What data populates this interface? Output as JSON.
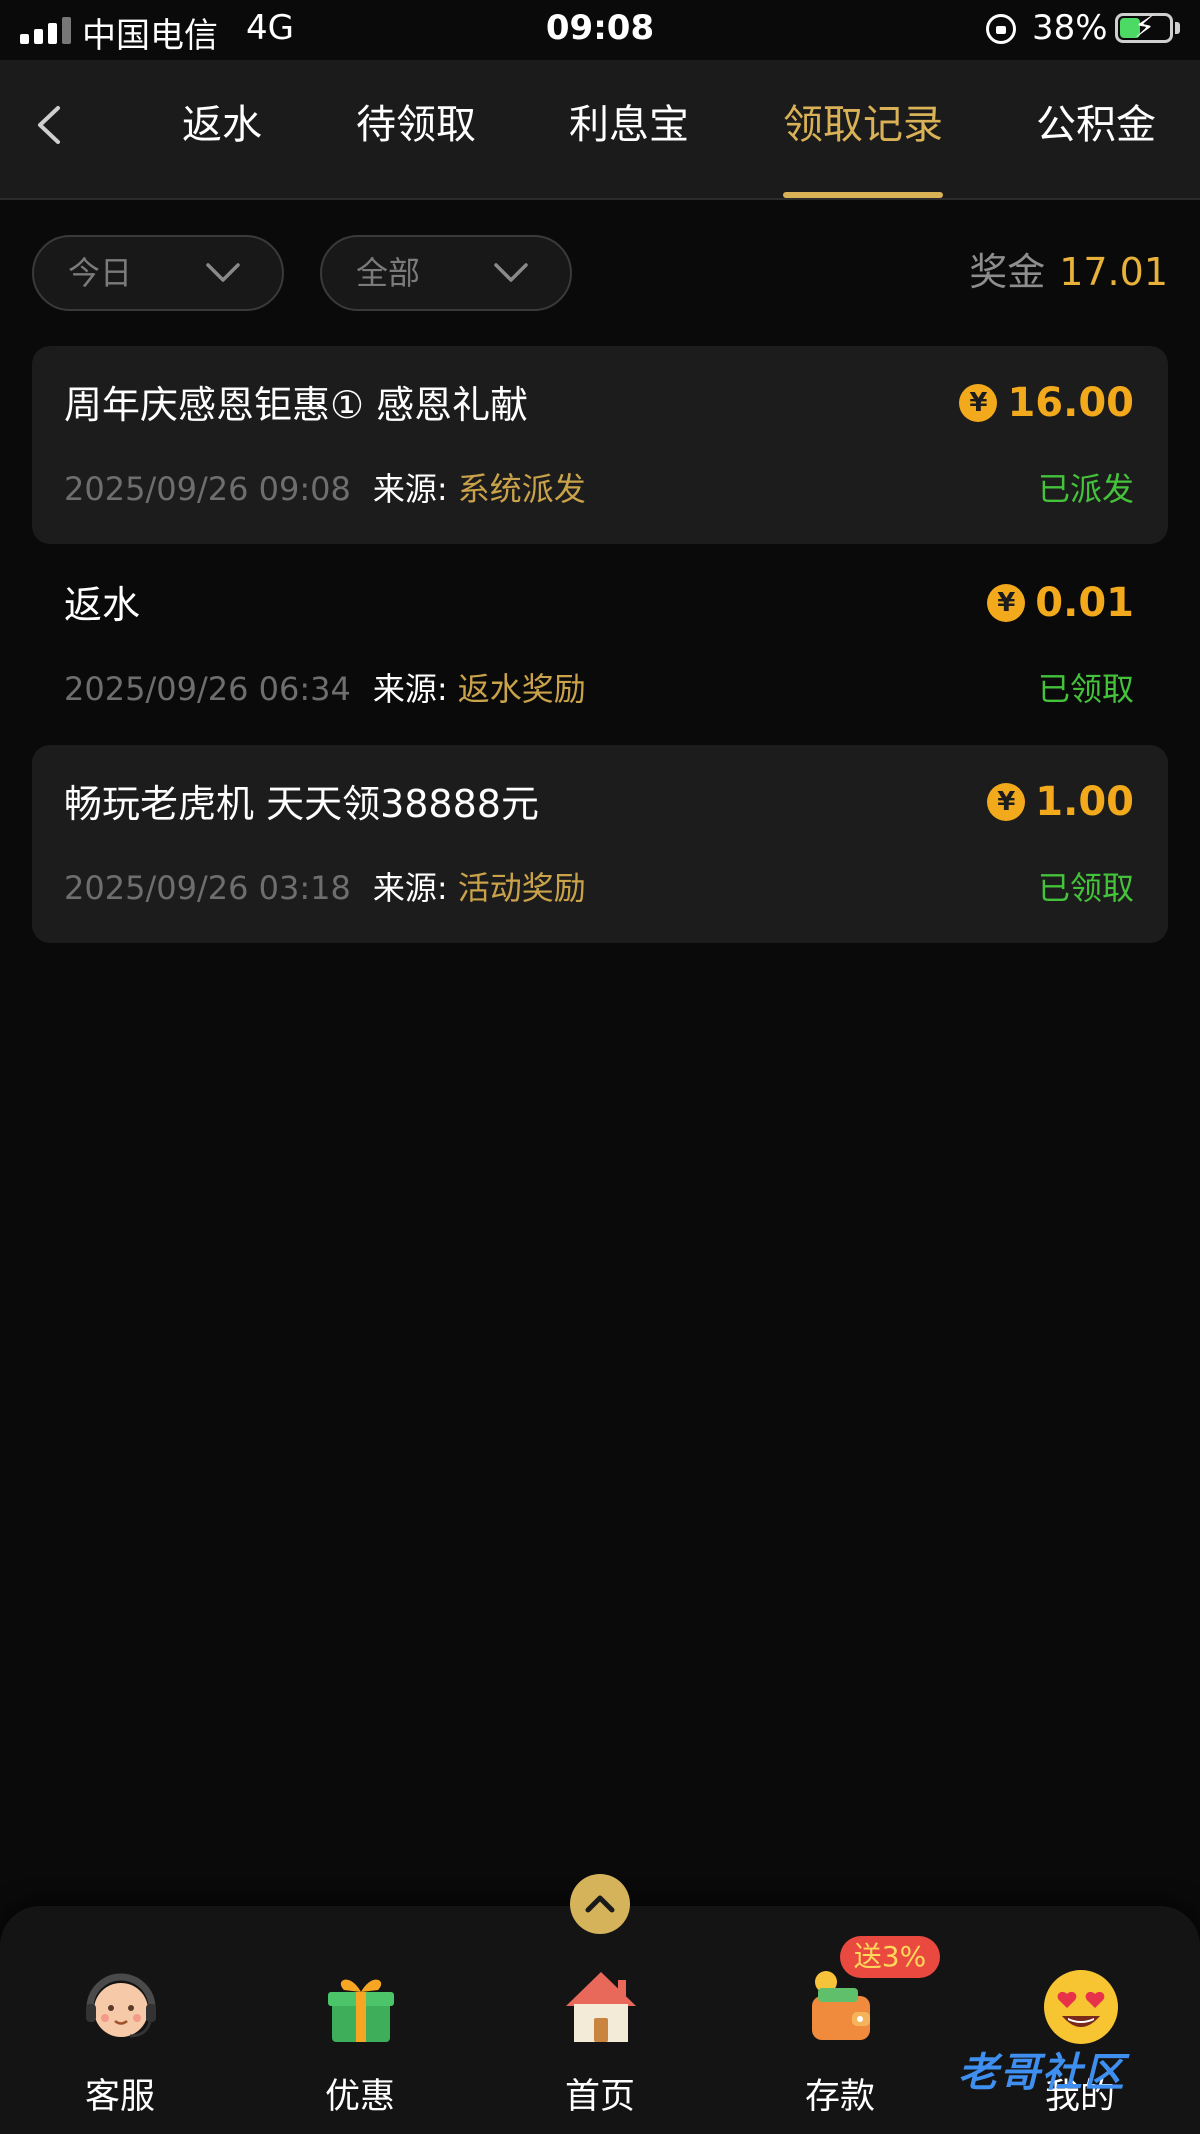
{
  "status_bar": {
    "carrier": "中国电信",
    "network": "4G",
    "time": "09:08",
    "battery_pct": "38%",
    "battery_level": 0.38,
    "icons": [
      "signal-icon",
      "rotation-lock-icon",
      "battery-charging-icon"
    ]
  },
  "header": {
    "back_icon": "chevron-left-icon",
    "tabs": [
      {
        "label": "返水"
      },
      {
        "label": "待领取"
      },
      {
        "label": "利息宝"
      },
      {
        "label": "领取记录",
        "active": true
      },
      {
        "label": "公积金"
      }
    ]
  },
  "filters": {
    "date": {
      "value": "今日",
      "icon": "chevron-down-icon"
    },
    "type": {
      "value": "全部",
      "icon": "chevron-down-icon"
    }
  },
  "bonus": {
    "label": "奖金",
    "value": "17.01"
  },
  "records": [
    {
      "title": "周年庆感恩钜惠① 感恩礼献",
      "amount": "16.00",
      "coin": "¥",
      "date": "2025/09/26 09:08",
      "source_label": "来源:",
      "source": "系统派发",
      "status": "已派发"
    },
    {
      "title": "返水",
      "amount": "0.01",
      "coin": "¥",
      "date": "2025/09/26 06:34",
      "source_label": "来源:",
      "source": "返水奖励",
      "status": "已领取"
    },
    {
      "title": "畅玩老虎机 天天领38888元",
      "amount": "1.00",
      "coin": "¥",
      "date": "2025/09/26 03:18",
      "source_label": "来源:",
      "source": "活动奖励",
      "status": "已领取"
    }
  ],
  "bottom_nav": {
    "scroll_top_icon": "chevron-up-icon",
    "items": [
      {
        "label": "客服",
        "icon": "support-agent-icon"
      },
      {
        "label": "优惠",
        "icon": "gift-icon"
      },
      {
        "label": "首页",
        "icon": "home-icon"
      },
      {
        "label": "存款",
        "icon": "wallet-icon",
        "badge": "送3%"
      },
      {
        "label": "我的",
        "icon": "heart-eyes-emoji-icon"
      }
    ]
  },
  "watermark": "老哥社区",
  "colors": {
    "accent_gold": "#d9b156",
    "amount_orange": "#f2a91c",
    "status_green": "#43c23a",
    "badge_red": "#e9493f"
  }
}
